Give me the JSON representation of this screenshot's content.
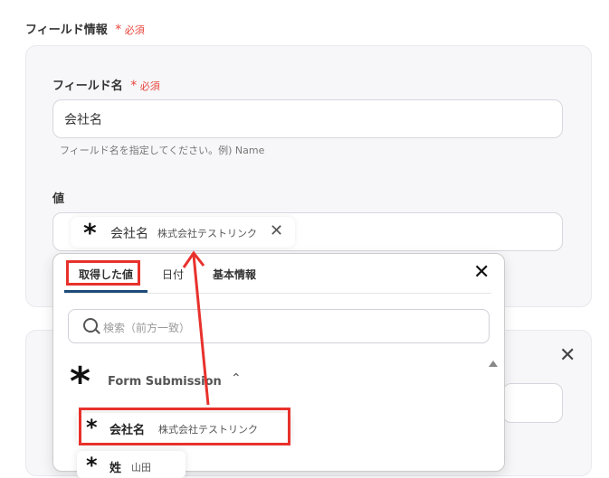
{
  "section": {
    "title": "フィールド情報",
    "required_mark": "*",
    "required_text": "必須"
  },
  "field_name": {
    "label": "フィールド名",
    "required_mark": "*",
    "required_text": "必須",
    "value": "会社名",
    "hint": "フィールド名を指定してください。例) Name"
  },
  "value_field": {
    "label": "値",
    "chip": {
      "icon": "asterisk-icon",
      "name": "会社名",
      "value": "株式会社テストリンク",
      "remove_icon": "close-icon"
    }
  },
  "dropdown": {
    "tabs": [
      {
        "label": "取得した値",
        "active": true
      },
      {
        "label": "日付",
        "active": false
      },
      {
        "label": "基本情報",
        "active": false
      }
    ],
    "close_icon": "close-icon",
    "search": {
      "placeholder": "検索（前方一致）",
      "icon": "search-icon"
    },
    "group": {
      "label": "Form Submission",
      "icon": "asterisk-icon",
      "chevron": "chevron-up-icon"
    },
    "items": [
      {
        "name": "会社名",
        "value": "株式会社テストリンク",
        "highlighted": true
      },
      {
        "name": "姓",
        "value": "山田",
        "highlighted": false
      }
    ]
  },
  "card2": {
    "close_icon": "close-icon"
  },
  "colors": {
    "required": "#e8453c",
    "highlight_box": "#e8312c",
    "tab_underline": "#1c4c7a"
  }
}
